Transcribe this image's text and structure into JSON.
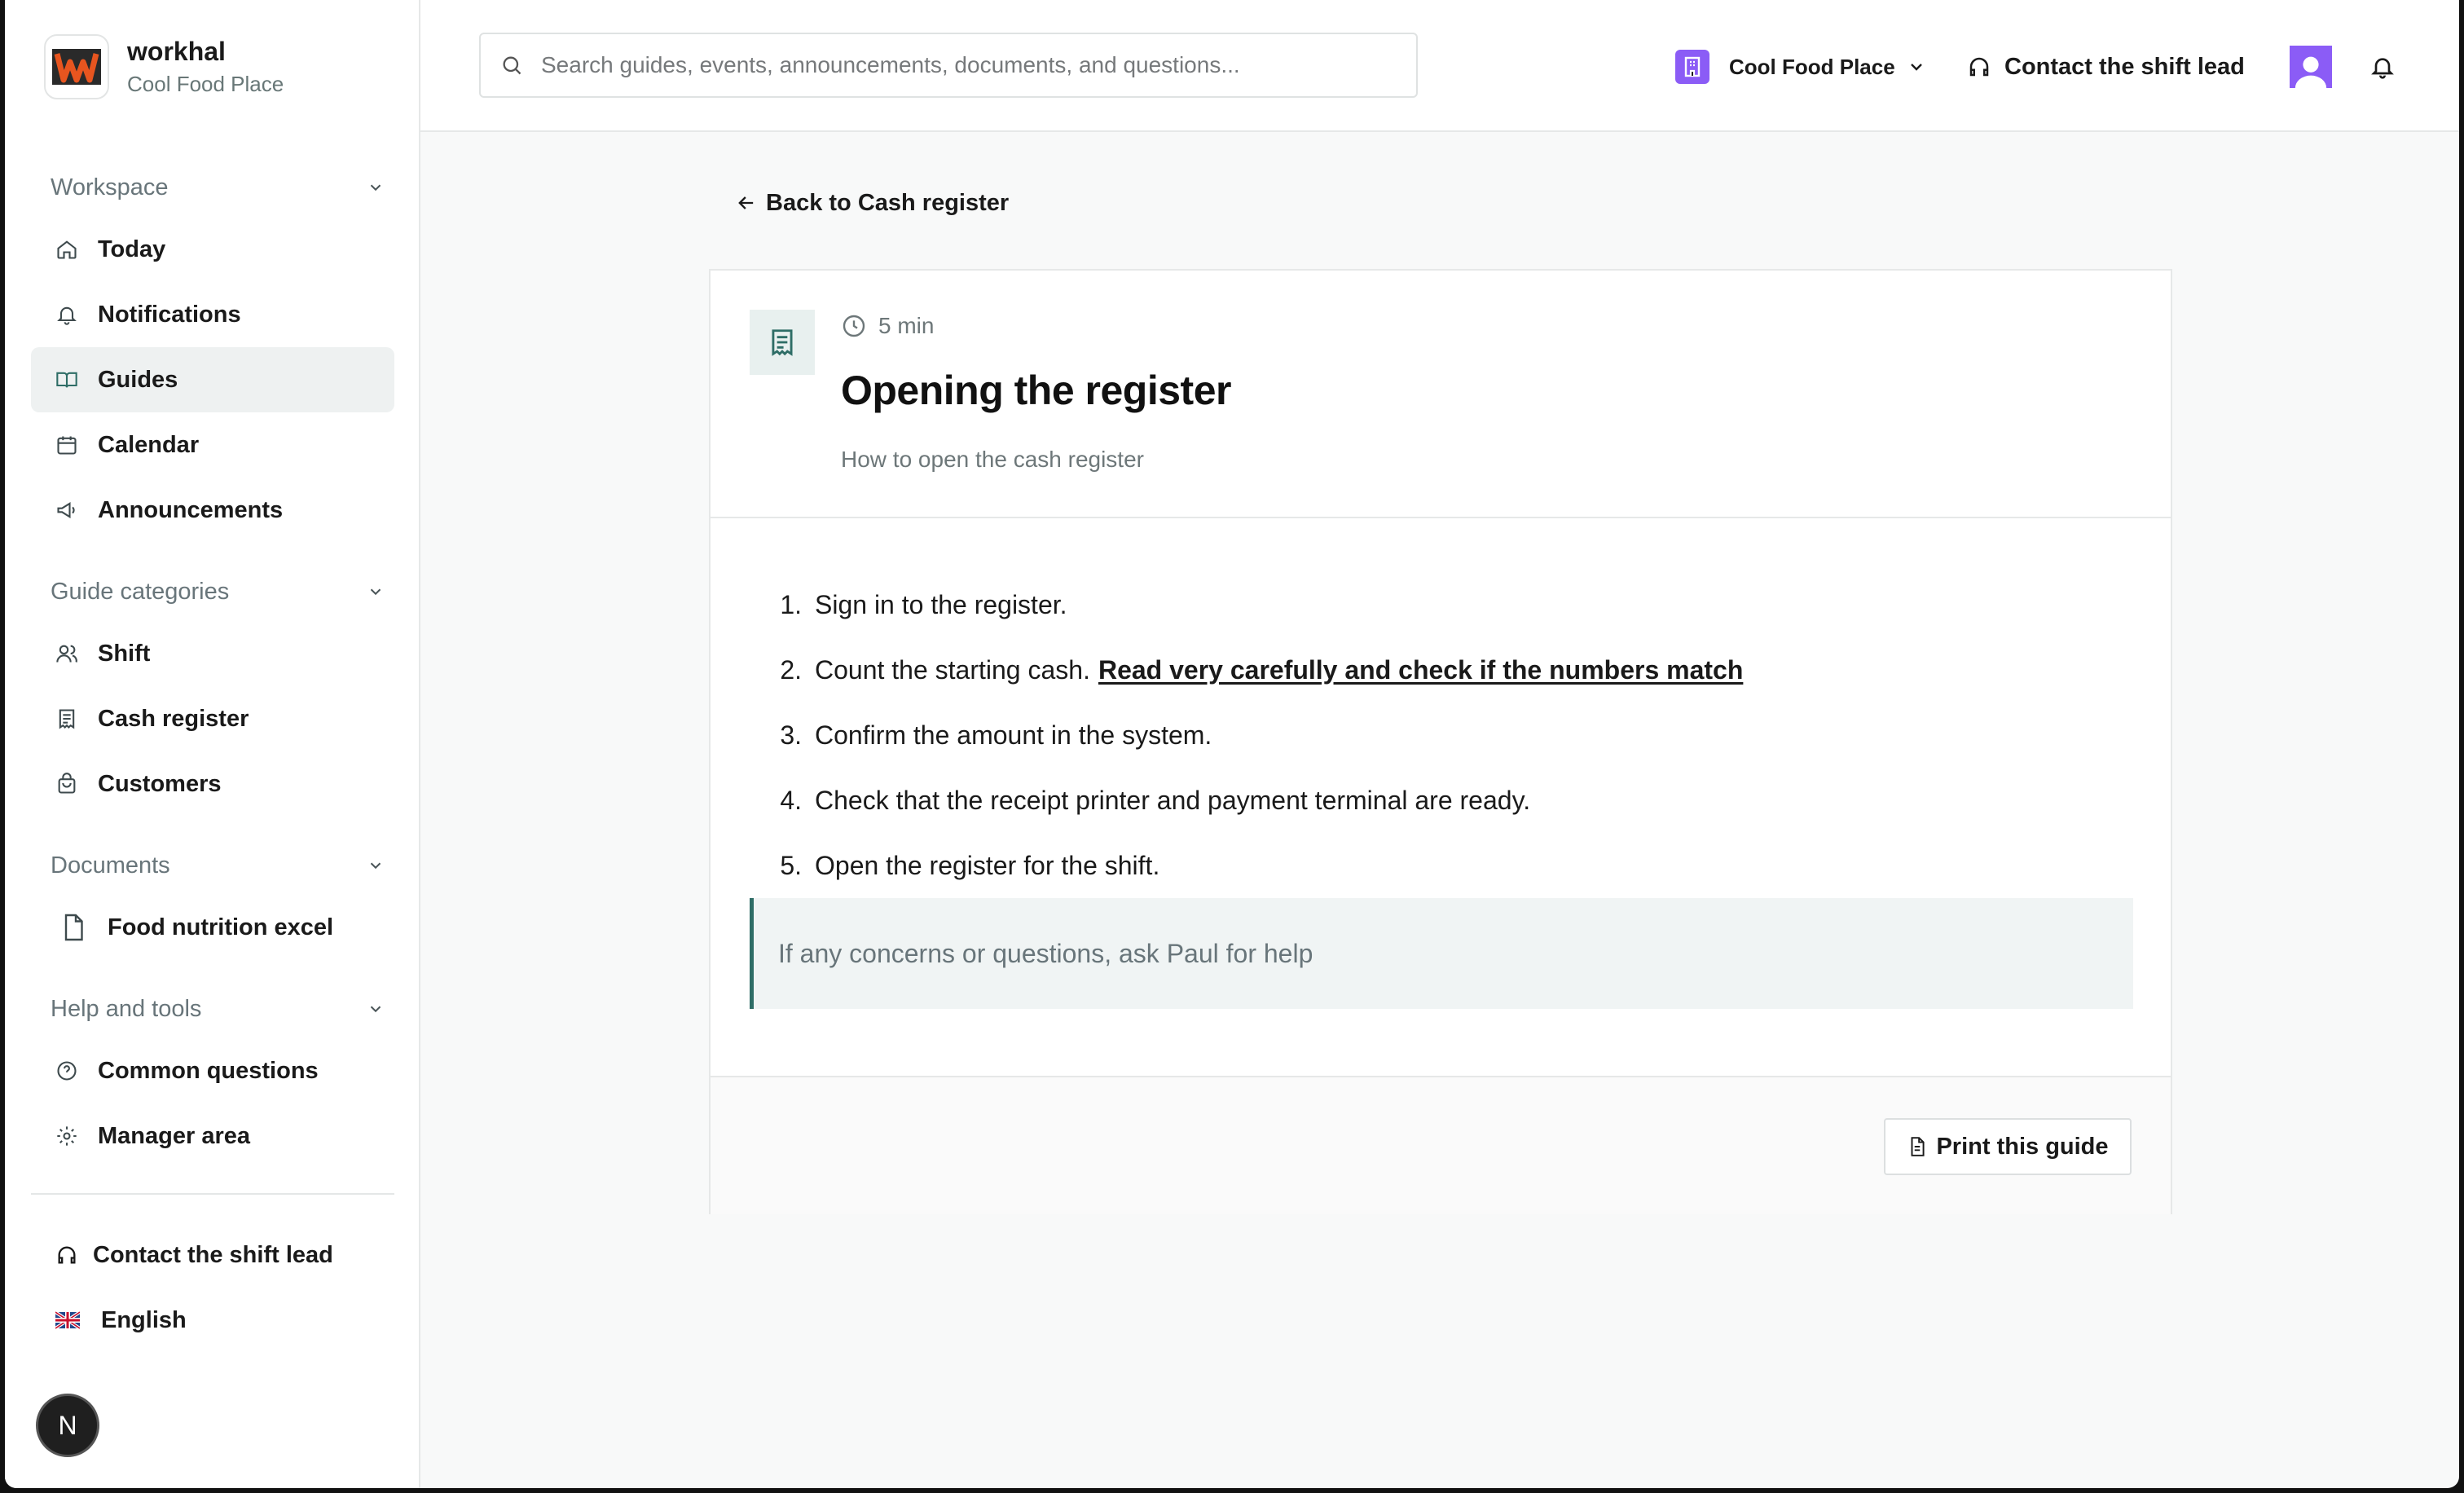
{
  "brand": {
    "name": "workhal",
    "workspace": "Cool Food Place"
  },
  "sidebar": {
    "sections": [
      {
        "title": "Workspace",
        "items": [
          {
            "label": "Today",
            "icon": "home-icon"
          },
          {
            "label": "Notifications",
            "icon": "bell-icon"
          },
          {
            "label": "Guides",
            "icon": "book-icon",
            "active": true
          },
          {
            "label": "Calendar",
            "icon": "calendar-icon"
          },
          {
            "label": "Announcements",
            "icon": "megaphone-icon"
          }
        ]
      },
      {
        "title": "Guide categories",
        "items": [
          {
            "label": "Shift",
            "icon": "users-icon"
          },
          {
            "label": "Cash register",
            "icon": "receipt-icon"
          },
          {
            "label": "Customers",
            "icon": "shopping-bag-icon"
          }
        ]
      },
      {
        "title": "Documents",
        "items": [
          {
            "label": "Food nutrition excel",
            "icon": "file-icon"
          }
        ]
      },
      {
        "title": "Help and tools",
        "items": [
          {
            "label": "Common questions",
            "icon": "help-circle-icon"
          },
          {
            "label": "Manager area",
            "icon": "gear-icon"
          }
        ]
      }
    ],
    "footer": {
      "contact_label": "Contact the shift lead",
      "language_label": "English",
      "language_icon": "uk-flag-icon"
    },
    "dev_badge": "N"
  },
  "header": {
    "search_placeholder": "Search guides, events, announcements, documents, and questions...",
    "location": "Cool Food Place",
    "contact_label": "Contact the shift lead",
    "accent_color": "#8b5cf6"
  },
  "guide": {
    "back_label": "Back to Cash register",
    "duration": "5 min",
    "title": "Opening the register",
    "subtitle": "How to open the cash register",
    "steps": [
      {
        "num": "1.",
        "text": "Sign in to the register.",
        "emphasis": ""
      },
      {
        "num": "2.",
        "text": "Count the starting cash.",
        "emphasis": "Read very carefully and check if the numbers match"
      },
      {
        "num": "3.",
        "text": "Confirm the amount in the system.",
        "emphasis": ""
      },
      {
        "num": "4.",
        "text": "Check that the receipt printer and payment terminal are ready.",
        "emphasis": ""
      },
      {
        "num": "5.",
        "text": "Open the register for the shift.",
        "emphasis": ""
      }
    ],
    "note": "If any concerns or questions, ask Paul for help",
    "print_label": "Print this guide",
    "note_border_color": "#2e6d66"
  }
}
